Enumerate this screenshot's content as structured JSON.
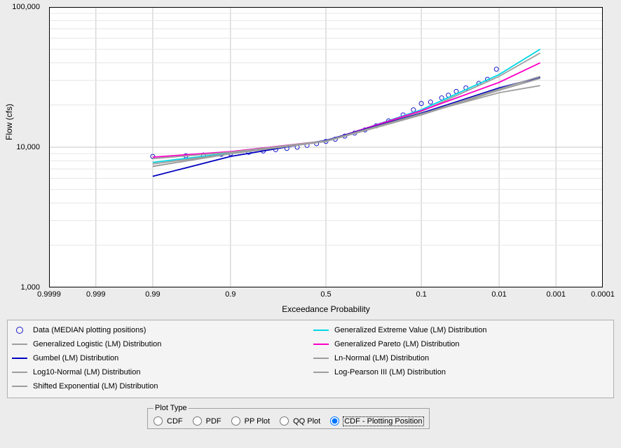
{
  "chart_data": {
    "type": "line+scatter",
    "xlabel": "Exceedance Probability",
    "ylabel": "Flow (cfs)",
    "x_axis_scale": "normal-probability (inverted)",
    "y_axis_scale": "log10",
    "ylim": [
      1000,
      100000
    ],
    "x_ticks": [
      0.9999,
      0.999,
      0.99,
      0.9,
      0.5,
      0.1,
      0.01,
      0.001,
      0.0001
    ],
    "x_ticklabels": [
      "0.9999",
      "0.999",
      "0.99",
      "0.9",
      "0.5",
      "0.1",
      "0.01",
      "0.001",
      "0.0001"
    ],
    "y_ticks": [
      1000,
      10000,
      100000
    ],
    "y_ticklabels": [
      "1,000",
      "10,000",
      "100,000"
    ],
    "series": [
      {
        "name": "Data (MEDIAN plotting positions)",
        "kind": "scatter",
        "color": "#1a1acc",
        "points": [
          {
            "x": 0.99,
            "y": 8600
          },
          {
            "x": 0.97,
            "y": 8700
          },
          {
            "x": 0.95,
            "y": 8800
          },
          {
            "x": 0.92,
            "y": 8900
          },
          {
            "x": 0.9,
            "y": 9000
          },
          {
            "x": 0.85,
            "y": 9200
          },
          {
            "x": 0.8,
            "y": 9400
          },
          {
            "x": 0.75,
            "y": 9600
          },
          {
            "x": 0.7,
            "y": 9800
          },
          {
            "x": 0.65,
            "y": 10000
          },
          {
            "x": 0.6,
            "y": 10300
          },
          {
            "x": 0.55,
            "y": 10600
          },
          {
            "x": 0.5,
            "y": 11000
          },
          {
            "x": 0.45,
            "y": 11400
          },
          {
            "x": 0.4,
            "y": 12000
          },
          {
            "x": 0.35,
            "y": 12600
          },
          {
            "x": 0.3,
            "y": 13300
          },
          {
            "x": 0.25,
            "y": 14200
          },
          {
            "x": 0.2,
            "y": 15400
          },
          {
            "x": 0.15,
            "y": 17000
          },
          {
            "x": 0.12,
            "y": 18500
          },
          {
            "x": 0.1,
            "y": 20500
          },
          {
            "x": 0.08,
            "y": 21000
          },
          {
            "x": 0.06,
            "y": 22500
          },
          {
            "x": 0.05,
            "y": 23500
          },
          {
            "x": 0.04,
            "y": 25000
          },
          {
            "x": 0.03,
            "y": 26500
          },
          {
            "x": 0.02,
            "y": 28500
          },
          {
            "x": 0.015,
            "y": 30500
          },
          {
            "x": 0.011,
            "y": 36000
          }
        ]
      },
      {
        "name": "Generalized Extreme Value (LM) Distribution",
        "kind": "line",
        "color": "#00d7e6",
        "points": [
          {
            "x": 0.99,
            "y": 7800
          },
          {
            "x": 0.9,
            "y": 9100
          },
          {
            "x": 0.5,
            "y": 11000
          },
          {
            "x": 0.1,
            "y": 18500
          },
          {
            "x": 0.01,
            "y": 33000
          },
          {
            "x": 0.002,
            "y": 50000
          }
        ]
      },
      {
        "name": "Generalized Logistic (LM) Distribution",
        "kind": "line",
        "color": "#9e9e9e",
        "points": [
          {
            "x": 0.99,
            "y": 7600
          },
          {
            "x": 0.9,
            "y": 9000
          },
          {
            "x": 0.5,
            "y": 11000
          },
          {
            "x": 0.1,
            "y": 18000
          },
          {
            "x": 0.01,
            "y": 32000
          },
          {
            "x": 0.002,
            "y": 47000
          }
        ]
      },
      {
        "name": "Generalized Pareto (LM) Distribution",
        "kind": "line",
        "color": "#ff00c8",
        "points": [
          {
            "x": 0.99,
            "y": 8500
          },
          {
            "x": 0.9,
            "y": 9300
          },
          {
            "x": 0.5,
            "y": 11100
          },
          {
            "x": 0.1,
            "y": 18200
          },
          {
            "x": 0.01,
            "y": 29000
          },
          {
            "x": 0.002,
            "y": 40000
          }
        ]
      },
      {
        "name": "Gumbel (LM) Distribution",
        "kind": "line",
        "color": "#0000c0",
        "points": [
          {
            "x": 0.99,
            "y": 6200
          },
          {
            "x": 0.9,
            "y": 8600
          },
          {
            "x": 0.5,
            "y": 11200
          },
          {
            "x": 0.1,
            "y": 17500
          },
          {
            "x": 0.01,
            "y": 26500
          },
          {
            "x": 0.002,
            "y": 31500
          }
        ]
      },
      {
        "name": "Ln-Normal (LM) Distribution",
        "kind": "line",
        "color": "#9e9e9e",
        "points": [
          {
            "x": 0.99,
            "y": 7300
          },
          {
            "x": 0.9,
            "y": 9000
          },
          {
            "x": 0.5,
            "y": 11000
          },
          {
            "x": 0.1,
            "y": 17000
          },
          {
            "x": 0.01,
            "y": 25500
          },
          {
            "x": 0.002,
            "y": 31000
          }
        ]
      },
      {
        "name": "Log10-Normal (LM) Distribution",
        "kind": "line",
        "color": "#9e9e9e",
        "points": [
          {
            "x": 0.99,
            "y": 7300
          },
          {
            "x": 0.9,
            "y": 9000
          },
          {
            "x": 0.5,
            "y": 11000
          },
          {
            "x": 0.1,
            "y": 17000
          },
          {
            "x": 0.01,
            "y": 25500
          },
          {
            "x": 0.002,
            "y": 31000
          }
        ]
      },
      {
        "name": "Log-Pearson III (LM) Distribution",
        "kind": "line",
        "color": "#9e9e9e",
        "points": [
          {
            "x": 0.99,
            "y": 7300
          },
          {
            "x": 0.9,
            "y": 9000
          },
          {
            "x": 0.5,
            "y": 11000
          },
          {
            "x": 0.1,
            "y": 17200
          },
          {
            "x": 0.01,
            "y": 26000
          },
          {
            "x": 0.002,
            "y": 32000
          }
        ]
      },
      {
        "name": "Shifted Exponential (LM) Distribution",
        "kind": "line",
        "color": "#9e9e9e",
        "points": [
          {
            "x": 0.99,
            "y": 8300
          },
          {
            "x": 0.9,
            "y": 9200
          },
          {
            "x": 0.5,
            "y": 11100
          },
          {
            "x": 0.1,
            "y": 17300
          },
          {
            "x": 0.01,
            "y": 24500
          },
          {
            "x": 0.002,
            "y": 27500
          }
        ]
      }
    ]
  },
  "legend": [
    {
      "label": "Data (MEDIAN plotting positions)",
      "color": "#1a1acc",
      "kind": "scatter"
    },
    {
      "label": "Generalized Logistic (LM) Distribution",
      "color": "#9e9e9e",
      "kind": "line"
    },
    {
      "label": "Gumbel (LM) Distribution",
      "color": "#0000c0",
      "kind": "line"
    },
    {
      "label": "Log10-Normal (LM) Distribution",
      "color": "#9e9e9e",
      "kind": "line"
    },
    {
      "label": "Shifted Exponential (LM) Distribution",
      "color": "#9e9e9e",
      "kind": "line"
    },
    {
      "label": "Generalized Extreme Value (LM) Distribution",
      "color": "#00d7e6",
      "kind": "line"
    },
    {
      "label": "Generalized Pareto (LM) Distribution",
      "color": "#ff00c8",
      "kind": "line"
    },
    {
      "label": "Ln-Normal (LM) Distribution",
      "color": "#9e9e9e",
      "kind": "line"
    },
    {
      "label": "Log-Pearson III (LM) Distribution",
      "color": "#9e9e9e",
      "kind": "line"
    }
  ],
  "plot_type": {
    "legend": "Plot Type",
    "options": [
      "CDF",
      "PDF",
      "PP Plot",
      "QQ Plot",
      "CDF - Plotting Position"
    ],
    "selected": "CDF - Plotting Position"
  }
}
